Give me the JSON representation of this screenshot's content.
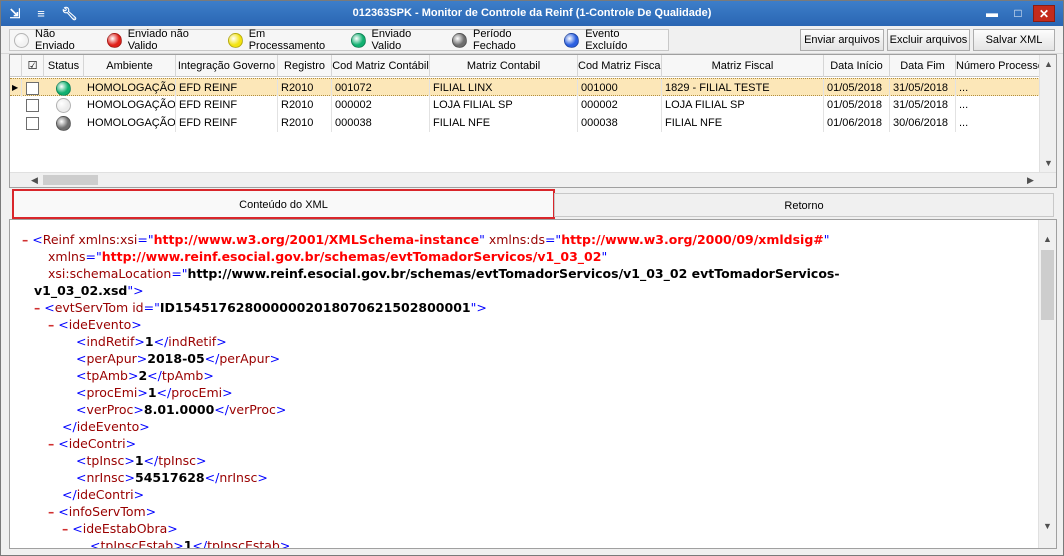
{
  "window": {
    "title": "012363SPK - Monitor de Controle da Reinf (1-Controle De Qualidade)",
    "icons": [
      "menu-icon",
      "traffic-light-icon",
      "wrench-icon"
    ],
    "controls": [
      "minimize",
      "maximize",
      "close"
    ]
  },
  "legend": [
    {
      "label": "Não Enviado",
      "color": "#f2f2f2"
    },
    {
      "label": "Enviado não Valido",
      "color": "#e0201a"
    },
    {
      "label": "Em Processamento",
      "color": "#f3e310"
    },
    {
      "label": "Enviado Valido",
      "color": "#10b070"
    },
    {
      "label": "Período Fechado",
      "color": "#6e6e6e"
    },
    {
      "label": "Evento Excluído",
      "color": "#2a5fe0"
    }
  ],
  "toolbar": {
    "enviar": "Enviar arquivos",
    "excluir": "Excluir arquivos",
    "salvar": "Salvar XML"
  },
  "grid": {
    "check_header": "☑",
    "columns": [
      "Status",
      "Ambiente",
      "Integração Governo",
      "Registro",
      "Cod Matriz Contábil",
      "Matriz Contabil",
      "Cod Matriz Fiscal",
      "Matriz Fiscal",
      "Data Início",
      "Data Fim",
      "Número Processo"
    ],
    "rows": [
      {
        "status_color": "#10b070",
        "cells": [
          "HOMOLOGAÇÃO",
          "EFD REINF",
          "R2010",
          "001072",
          "FILIAL LINX",
          "001000",
          "1829 - FILIAL TESTE",
          "01/05/2018",
          "31/05/2018",
          "..."
        ]
      },
      {
        "status_color": "#ebebeb",
        "cells": [
          "HOMOLOGAÇÃO",
          "EFD REINF",
          "R2010",
          "000002",
          "LOJA FILIAL SP",
          "000002",
          "LOJA FILIAL SP",
          "01/05/2018",
          "31/05/2018",
          "..."
        ]
      },
      {
        "status_color": "#6e6e6e",
        "cells": [
          "HOMOLOGAÇÃO",
          "EFD REINF",
          "R2010",
          "000038",
          "FILIAL NFE",
          "000038",
          "FILIAL NFE",
          "01/06/2018",
          "30/06/2018",
          "..."
        ]
      }
    ]
  },
  "tabs": {
    "xml": "Conteúdo do XML",
    "retorno": "Retorno"
  },
  "xml": {
    "root_tag": "Reinf",
    "xsi_attr": "xmlns:xsi",
    "xsi_val": "http://www.w3.org/2001/XMLSchema-instance",
    "ds_attr": "xmlns:ds",
    "ds_val": "http://www.w3.org/2000/09/xmldsig#",
    "xmlns_attr": "xmlns",
    "xmlns_val": "http://www.reinf.esocial.gov.br/schemas/evtTomadorServicos/v1_03_02",
    "schema_attr": "xsi:schemaLocation",
    "schema_val_1": "http://www.reinf.esocial.gov.br/schemas/evtTomadorServicos/v1_03_02 evtTomadorServicos-",
    "schema_val_2": "v1_03_02.xsd",
    "evt_tag": "evtServTom",
    "evt_id_attr": "id",
    "evt_id_val": "ID1545176280000002018070621502800001",
    "ideEvento": "ideEvento",
    "indRetif": "indRetif",
    "indRetif_val": "1",
    "perApur": "perApur",
    "perApur_val": "2018-05",
    "tpAmb": "tpAmb",
    "tpAmb_val": "2",
    "procEmi": "procEmi",
    "procEmi_val": "1",
    "verProc": "verProc",
    "verProc_val": "8.01.0000",
    "ideContri": "ideContri",
    "tpInsc": "tpInsc",
    "tpInsc_val": "1",
    "nrInsc": "nrInsc",
    "nrInsc_val": "54517628",
    "infoServTom": "infoServTom",
    "ideEstabObra": "ideEstabObra",
    "tpInscEstab": "tpInscEstab",
    "tpInscEstab_val": "1"
  }
}
